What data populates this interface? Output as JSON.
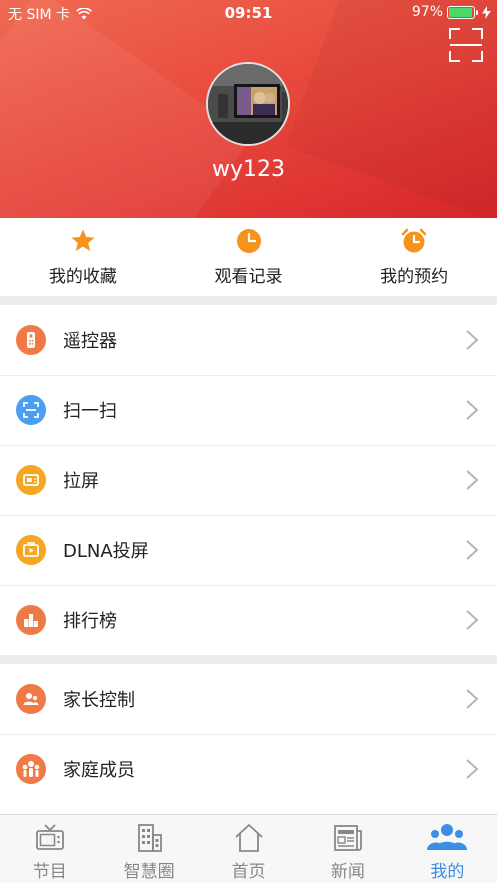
{
  "status_bar": {
    "carrier": "无 SIM 卡",
    "time": "09:51",
    "battery_percent": "97%",
    "battery_level": 0.97
  },
  "profile": {
    "username": "wy123"
  },
  "quick_actions": [
    {
      "label": "我的收藏",
      "icon": "star-icon"
    },
    {
      "label": "观看记录",
      "icon": "clock-icon"
    },
    {
      "label": "我的预约",
      "icon": "alarm-clock-icon"
    }
  ],
  "menu_group_1": [
    {
      "label": "遥控器",
      "icon": "remote-control-icon",
      "color": "#f07a45"
    },
    {
      "label": "扫一扫",
      "icon": "scan-icon",
      "color": "#4a9ff0"
    },
    {
      "label": "拉屏",
      "icon": "tv-screen-icon",
      "color": "#f5a623"
    },
    {
      "label": "DLNA投屏",
      "icon": "cast-screen-icon",
      "color": "#f5a623"
    },
    {
      "label": "排行榜",
      "icon": "podium-icon",
      "color": "#f07a45"
    }
  ],
  "menu_group_2": [
    {
      "label": "家长控制",
      "icon": "parental-control-icon",
      "color": "#f07a45"
    },
    {
      "label": "家庭成员",
      "icon": "family-members-icon",
      "color": "#f07a45"
    }
  ],
  "tabs": [
    {
      "label": "节目",
      "icon": "tv-icon",
      "active": false
    },
    {
      "label": "智慧圈",
      "icon": "building-icon",
      "active": false
    },
    {
      "label": "首页",
      "icon": "home-icon",
      "active": false
    },
    {
      "label": "新闻",
      "icon": "newspaper-icon",
      "active": false
    },
    {
      "label": "我的",
      "icon": "user-icon",
      "active": true
    }
  ],
  "colors": {
    "header_red": "#e84a3d",
    "accent_orange": "#f07a45",
    "active_tab_blue": "#3a8ee6"
  }
}
